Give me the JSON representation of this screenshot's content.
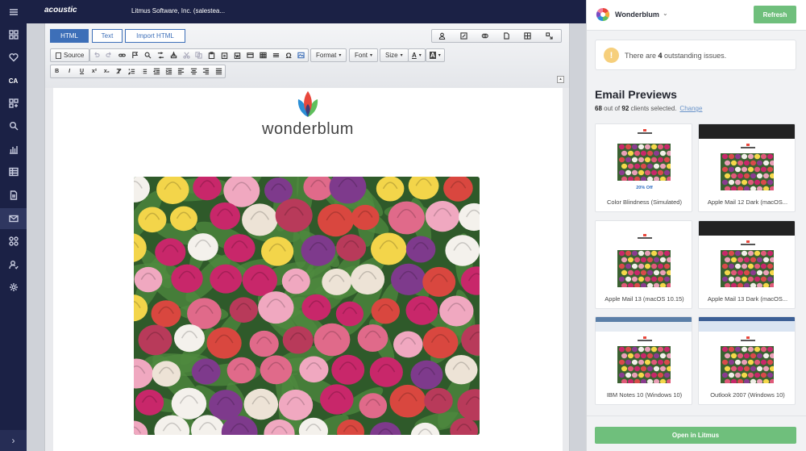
{
  "topbar": {
    "brand": "acoustic",
    "company": "Litmus Software, Inc. (salestea..."
  },
  "rail": {
    "items": [
      {
        "name": "menu-icon"
      },
      {
        "name": "dashboard-icon"
      },
      {
        "name": "heart-icon"
      },
      {
        "name": "ca-badge",
        "label": "CA"
      },
      {
        "name": "apps-icon"
      },
      {
        "name": "search-icon"
      },
      {
        "name": "bar-chart-icon"
      },
      {
        "name": "table-icon"
      },
      {
        "name": "document-icon"
      },
      {
        "name": "mail-icon",
        "active": true
      },
      {
        "name": "integrations-icon"
      },
      {
        "name": "user-settings-icon"
      },
      {
        "name": "gear-icon"
      },
      {
        "name": "expand-icon",
        "label": "›"
      }
    ]
  },
  "editor": {
    "modes": [
      {
        "label": "HTML",
        "active": true
      },
      {
        "label": "Text",
        "active": false
      },
      {
        "label": "Import HTML",
        "active": false
      }
    ],
    "toolbar": {
      "source_label": "Source",
      "format_label": "Format",
      "font_label": "Font",
      "size_label": "Size",
      "text_color_label": "A",
      "bg_color_label": "A"
    },
    "formatting": [
      "B",
      "I",
      "U",
      "x²",
      "x₂"
    ],
    "email": {
      "logo_text": "wonderblum"
    }
  },
  "panel": {
    "account_name": "Wonderblum",
    "refresh_label": "Refresh",
    "issues": {
      "prefix": "There are ",
      "count": "4",
      "suffix": " outstanding issues."
    },
    "previews_title": "Email Previews",
    "clients_selected": "68",
    "clients_mid": " out of ",
    "clients_total": "92",
    "clients_suffix": " clients selected.",
    "change_label": "Change",
    "open_label": "Open in Litmus",
    "cards": [
      {
        "caption": "Color Blindness (Simulated)",
        "promo": "20% Off",
        "style": "light"
      },
      {
        "caption": "Apple Mail 12 Dark (macOS...",
        "style": "dark"
      },
      {
        "caption": "Apple Mail 13 (macOS 10.15)",
        "style": "light-plain"
      },
      {
        "caption": "Apple Mail 13 Dark (macOS...",
        "style": "dark"
      },
      {
        "caption": "IBM Notes 10 (Windows 10)",
        "style": "window-blue"
      },
      {
        "caption": "Outlook 2007 (Windows 10)",
        "style": "window-office"
      }
    ]
  },
  "colors": {
    "navy": "#1b2145",
    "accent_blue": "#3d6fb8",
    "green_button": "#6fbf7c",
    "warning": "#f6cf7c",
    "link": "#6a94c9"
  }
}
